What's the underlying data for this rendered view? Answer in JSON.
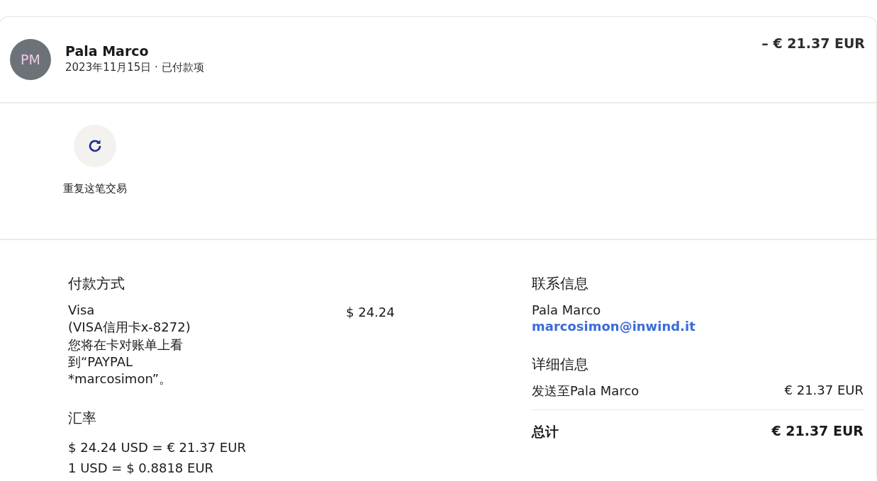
{
  "header": {
    "avatar_initials": "PM",
    "name": "Pala Marco",
    "subtitle": "2023年11月15日 · 已付款项",
    "amount": "– € 21.37 EUR"
  },
  "actions": [
    {
      "label": "重复这笔交易"
    }
  ],
  "payment": {
    "heading": "付款方式",
    "method": "Visa",
    "card": "(VISA信用卡x-8272)",
    "note": "您将在卡对账单上看到“PAYPAL *marcosimon”。",
    "amount": "$ 24.24"
  },
  "exchange": {
    "heading": "汇率",
    "lines": [
      "$ 24.24 USD = € 21.37 EUR",
      "1 USD = $ 0.8818 EUR"
    ]
  },
  "contact": {
    "heading": "联系信息",
    "name": "Pala Marco",
    "email": "marcosimon@inwind.it"
  },
  "details": {
    "heading": "详细信息",
    "rows": [
      {
        "label": "发送至Pala Marco",
        "value": "€ 21.37 EUR"
      }
    ],
    "total_label": "总计",
    "total_value": "€ 21.37 EUR"
  }
}
